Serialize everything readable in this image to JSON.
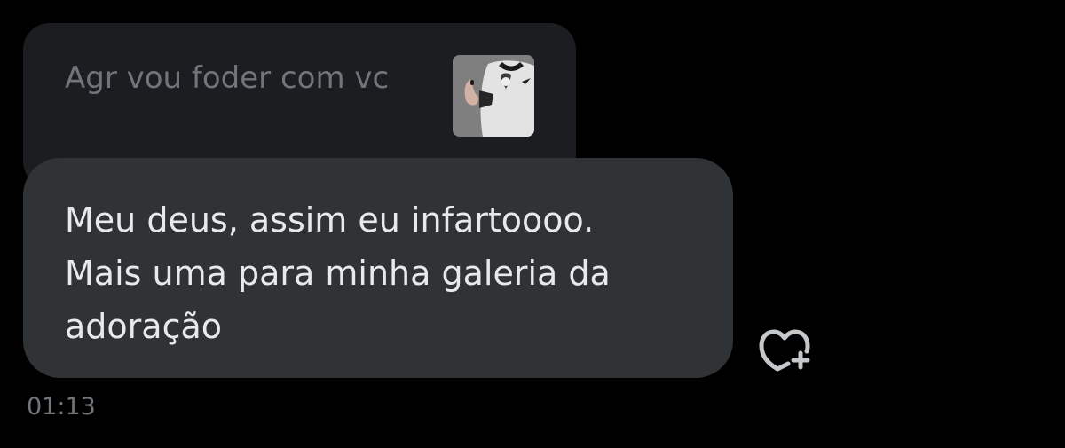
{
  "quoted_message": {
    "text": "Agr vou foder com vc",
    "media_icon": "photo-thumbnail"
  },
  "message": {
    "lines": [
      "Meu deus, assim eu infartoooo.",
      "Mais uma para minha galeria da",
      "adoração"
    ]
  },
  "reaction_button": {
    "icon": "heart-plus-icon"
  },
  "timestamp": "01:13",
  "colors": {
    "background": "#000000",
    "quote_bubble": "#1b1d20",
    "message_bubble": "#2f3336",
    "primary_text": "#e7e9ea",
    "secondary_text": "#71767b"
  }
}
